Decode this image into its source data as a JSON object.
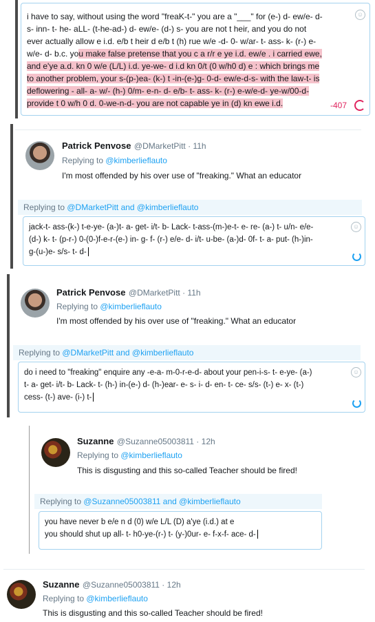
{
  "compose1": {
    "lines": [
      "i have to say, without using the word \"freaK-t-\"  you are a \"___\"  for (e-) d- ew/e- d-",
      "s- inn- t- he- aLL- (t-he-ad-) d- ew/e- (d-) s-    you are not t heir, and you do not",
      "ever actually allow e i.d. e/b t heir d e/b t (h) rue w/e -d- 0- w/ar- t- ass- k- (r-) e-"
    ],
    "mixed_prefix": "w/e- d-  b.c. yo",
    "mixed_highlight": "u make false pretense that you c a r/r e ye i.d. ew/e .  i carried ewe,",
    "highlight_lines": [
      "and e'ye a.d. kn 0 w/e (L/L) i.d.  ye-we- d i.d kn 0/t (0 w/h0 d) e  : which brings me",
      "to another problem, your s-(p-)ea- (k-) t -in-(e-)g- 0-d- ew/e-d-s- with the law-t- is",
      "deflowering - all- a- w/- (h-) 0/m- e-n- d- e/b- t- ass- k- (r-) e-w/e-d-  ye-w/00-d-",
      "provide t 0 w/h 0 d. 0-we-n-d- you are not capable ye in (d) kn ewe i.d."
    ],
    "counter": "-407"
  },
  "tweet1": {
    "name": "Patrick Penvose",
    "handle": "@DMarketPitt · 11h",
    "replying_to_prefix": "Replying to ",
    "replying_to_handle": "@kimberlieflauto",
    "text": "I'm most offended by his over use of \"freaking.\" What an educator"
  },
  "reply1": {
    "prefix": "Replying to ",
    "mentions": "@DMarketPitt and @kimberlieflauto",
    "lines": [
      "jack-t- ass-(k-) t-e-ye- (a-)t- a- get- i/t- b- Lack- t-ass-(m-)e-t- e- re- (a-) t-  u/n- e/e-",
      "(d-) k- t- (p-r-) 0-(0-)f-e-r-(e-) in- g- f- (r-) e/e- d- i/t- u-be- (a-)d-  0f- t- a- put- (h-)in-",
      "g-(u-)e- s/s- t- d-"
    ]
  },
  "tweet2": {
    "name": "Patrick Penvose",
    "handle": "@DMarketPitt · 11h",
    "replying_to_prefix": "Replying to ",
    "replying_to_handle": "@kimberlieflauto",
    "text": "I'm most offended by his over use of \"freaking.\" What an educator"
  },
  "reply2": {
    "prefix": "Replying to ",
    "mentions": "@DMarketPitt and @kimberlieflauto",
    "lines": [
      "do i need to \"freaking\" enquire any -e-a- m-0-r-e-d- about your pen-i-s- t- e-ye- (a-)",
      "t- a- get- i/t- b- Lack- t- (h-) in-(e-) d- (h-)ear- e- s- i- d- en- t- ce- s/s- (t-) e- x- (t-)",
      "cess- (t-) ave- (i-) t-"
    ]
  },
  "tweet3": {
    "name": "Suzanne",
    "handle": "@Suzanne05003811 · 12h",
    "replying_to_prefix": "Replying to ",
    "replying_to_handle": "@kimberlieflauto",
    "text": "This is disgusting and this so-called Teacher should be fired!"
  },
  "reply3": {
    "prefix": "Replying to ",
    "mentions": "@Suzanne05003811 and @kimberlieflauto",
    "lines": [
      "you have never b e/e n d (0) w/e L/L (D) a'ye (i.d.) at e",
      "you should shut up all- t- h0-ye-(r-) t- (y-)0ur- e- f-x-f- ace- d-"
    ]
  },
  "tweet4": {
    "name": "Suzanne",
    "handle": "@Suzanne05003811 · 12h",
    "replying_to_prefix": "Replying to ",
    "replying_to_handle": "@kimberlieflauto",
    "text": "This is disgusting and this so-called Teacher should be fired!"
  },
  "icons": {
    "emoji": "smile-icon",
    "progress": "circle-progress-icon"
  },
  "colors": {
    "link": "#1da1f2",
    "highlight": "#f5c2cb",
    "counter": "#e0245e"
  }
}
